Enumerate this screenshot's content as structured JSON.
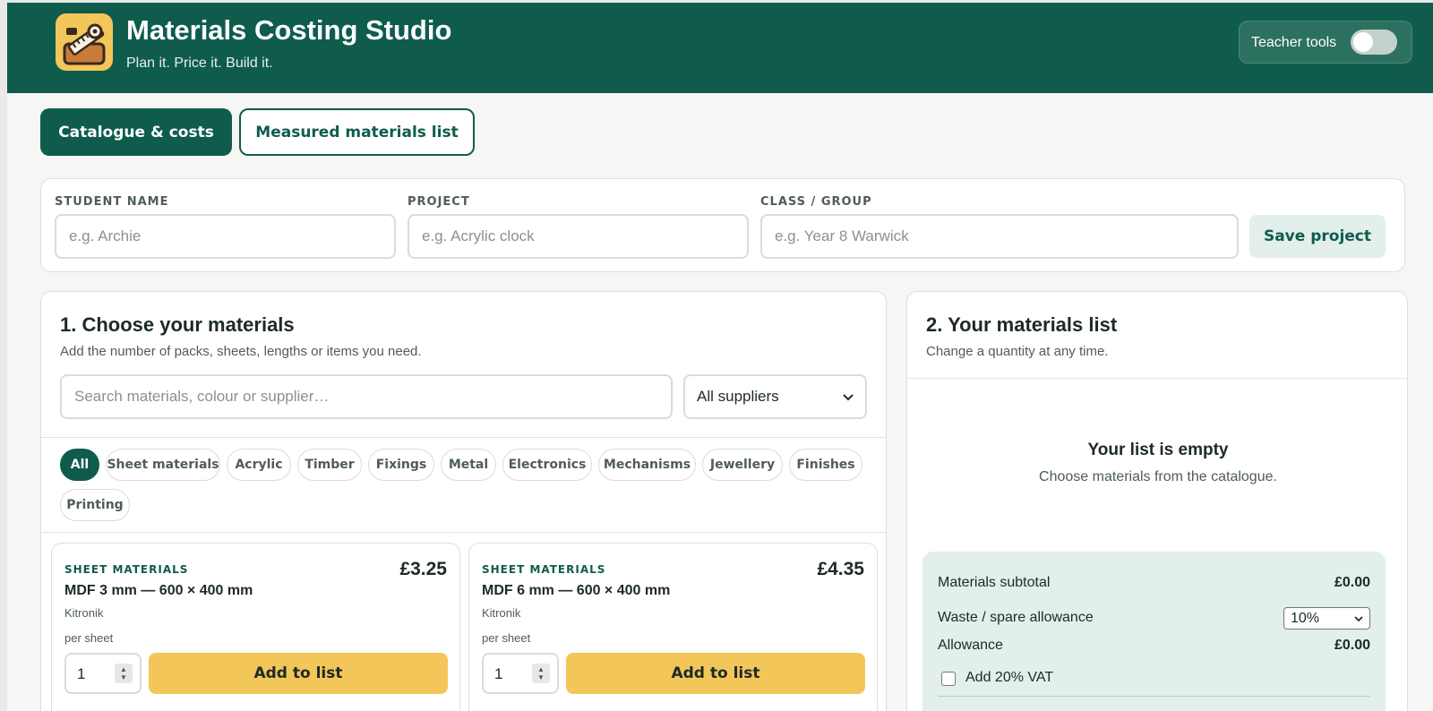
{
  "header": {
    "title": "Materials Costing Studio",
    "subtitle": "Plan it. Price it. Build it.",
    "teacher_tools_label": "Teacher tools",
    "logo_icon": "ruler-saw-toolbox-icon"
  },
  "tabs": [
    {
      "label": "Catalogue & costs",
      "active": true
    },
    {
      "label": "Measured materials list",
      "active": false
    }
  ],
  "project": {
    "student_label": "STUDENT NAME",
    "student_placeholder": "e.g. Archie",
    "project_label": "PROJECT",
    "project_placeholder": "e.g. Acrylic clock",
    "class_label": "CLASS / GROUP",
    "class_placeholder": "e.g. Year 8 Warwick",
    "save_label": "Save project"
  },
  "catalogue": {
    "title": "1. Choose your materials",
    "subtitle": "Add the number of packs, sheets, lengths or items you need.",
    "search_placeholder": "Search materials, colour or supplier…",
    "supplier_selected": "All suppliers",
    "chips": [
      "All",
      "Sheet materials",
      "Acrylic",
      "Timber",
      "Fixings",
      "Metal",
      "Electronics",
      "Mechanisms",
      "Jewellery",
      "Finishes",
      "Printing"
    ],
    "active_chip": "All",
    "products": [
      {
        "category": "SHEET MATERIALS",
        "name": "MDF 3 mm — 600 × 400 mm",
        "supplier": "Kitronik",
        "unit": "per sheet",
        "price": "£3.25",
        "qty": "1",
        "add_label": "Add to list"
      },
      {
        "category": "SHEET MATERIALS",
        "name": "MDF 6 mm — 600 × 400 mm",
        "supplier": "Kitronik",
        "unit": "per sheet",
        "price": "£4.35",
        "qty": "1",
        "add_label": "Add to list"
      }
    ]
  },
  "list": {
    "title": "2. Your materials list",
    "subtitle": "Change a quantity at any time.",
    "empty_title": "Your list is empty",
    "empty_sub": "Choose materials from the catalogue.",
    "subtotal_label": "Materials subtotal",
    "subtotal_value": "£0.00",
    "waste_label": "Waste / spare allowance",
    "waste_selected": "10%",
    "allowance_label": "Allowance",
    "allowance_value": "£0.00",
    "vat_label": "Add 20% VAT",
    "vat_checked": false
  },
  "colors": {
    "brand": "#0f5c4c",
    "accent": "#f3c65a",
    "totals_bg": "#e2efea"
  }
}
